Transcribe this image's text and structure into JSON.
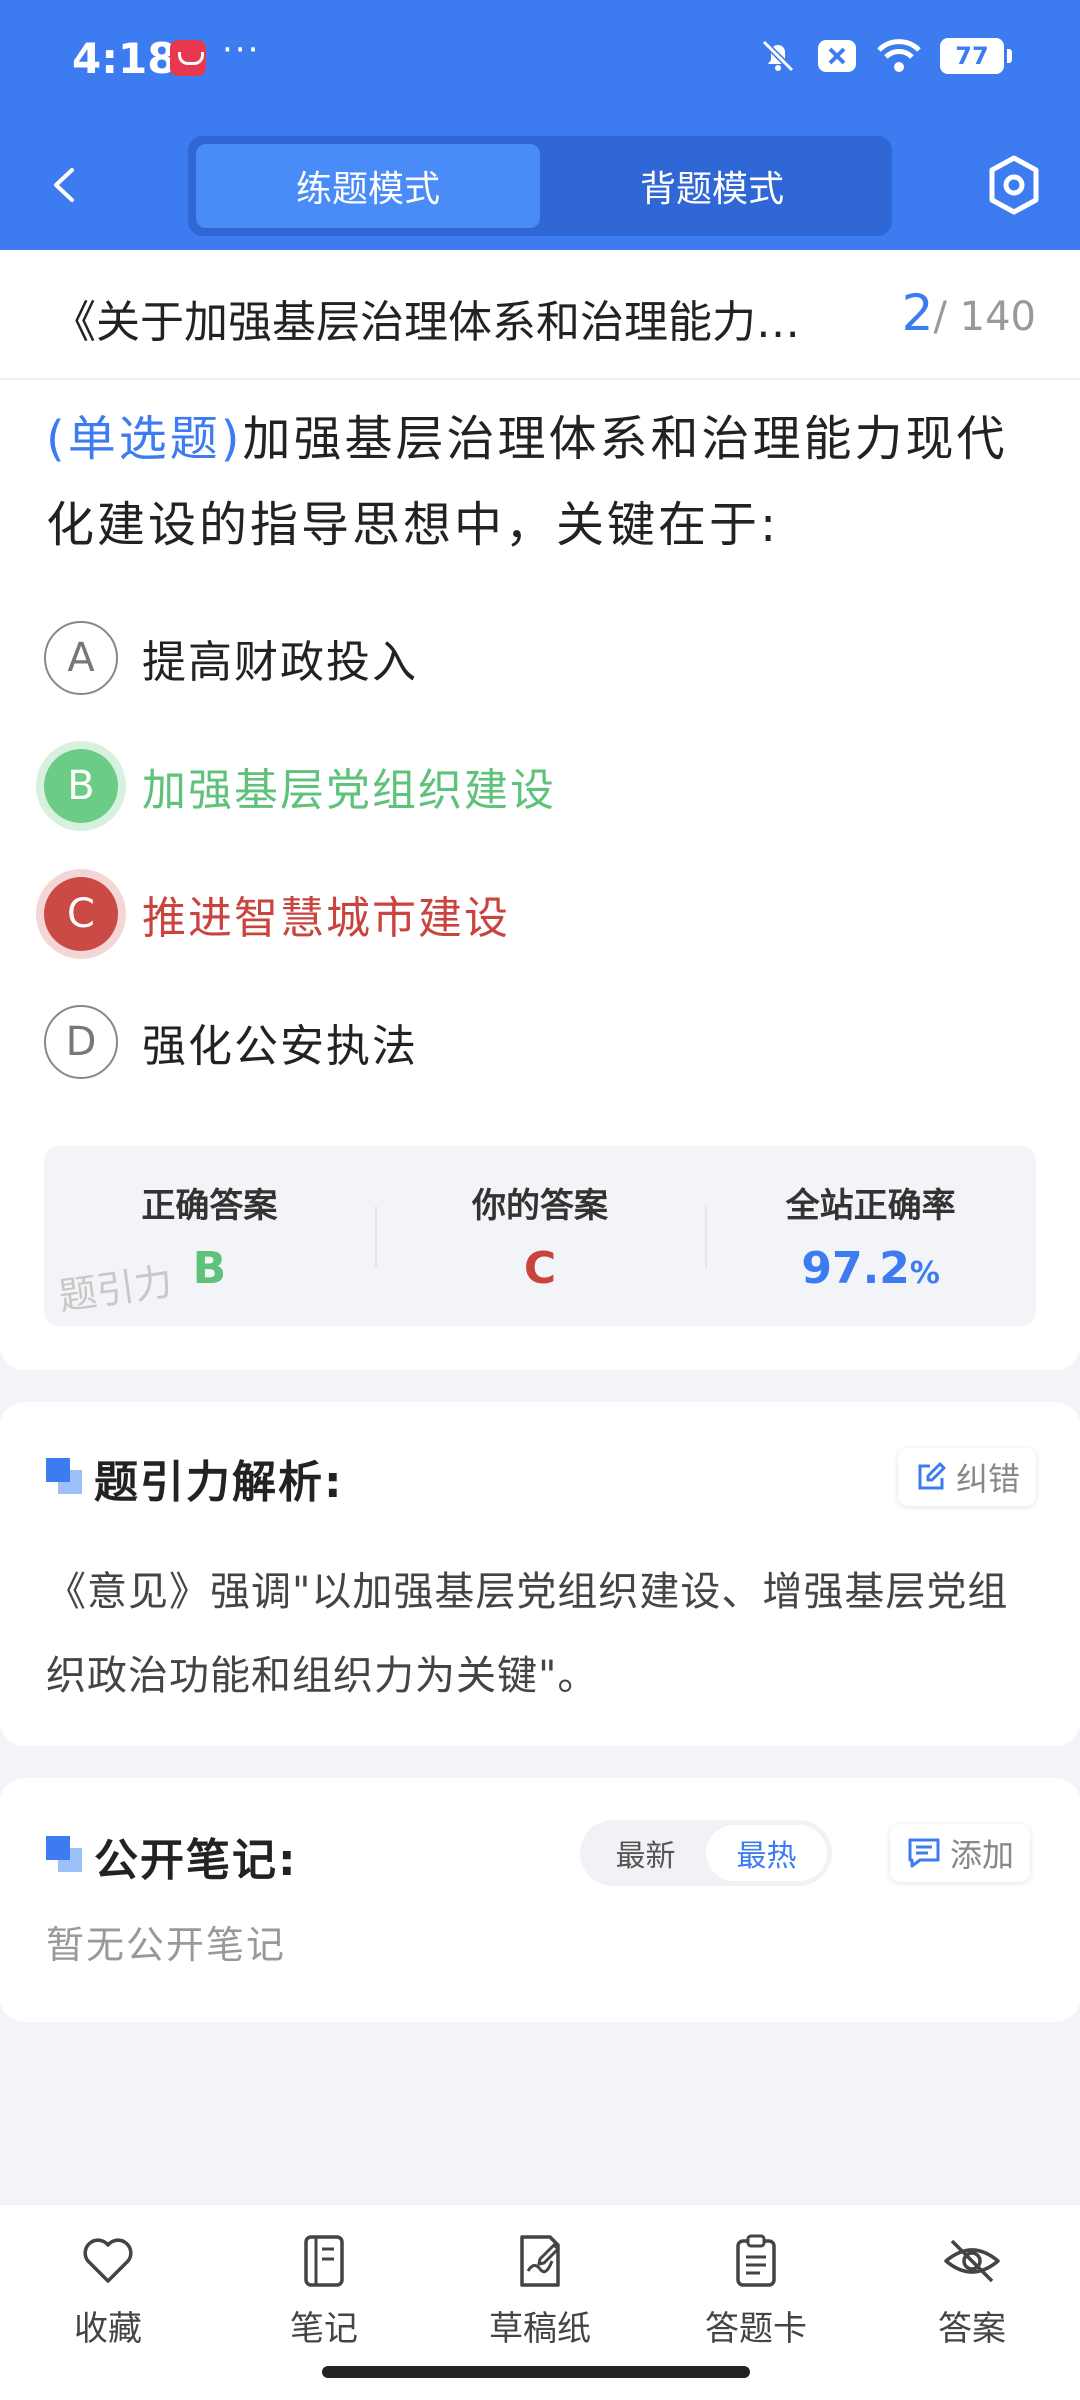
{
  "status_bar": {
    "time": "4:18",
    "more": "···",
    "battery": "77"
  },
  "nav": {
    "tab_practice": "练题模式",
    "tab_recite": "背题模式"
  },
  "question": {
    "doc_title": "《关于加强基层治理体系和治理能力…",
    "index_current": "2",
    "index_total": "/ 140",
    "type_label": "(单选题)",
    "text": "加强基层治理体系和治理能力现代化建设的指导思想中，关键在于:",
    "options": [
      {
        "letter": "A",
        "text": "提高财政投入"
      },
      {
        "letter": "B",
        "text": "加强基层党组织建设"
      },
      {
        "letter": "C",
        "text": "推进智慧城市建设"
      },
      {
        "letter": "D",
        "text": "强化公安执法"
      }
    ]
  },
  "answer_summary": {
    "correct_label": "正确答案",
    "correct_value": "B",
    "yours_label": "你的答案",
    "yours_value": "C",
    "rate_label": "全站正确率",
    "rate_value": "97.2",
    "rate_unit": "%",
    "watermark": "题引力"
  },
  "analysis": {
    "title": "题引力解析:",
    "report_label": "纠错",
    "text": "《意见》强调\"以加强基层党组织建设、增强基层党组织政治功能和组织力为关键\"。"
  },
  "notes": {
    "title": "公开笔记:",
    "sort_latest": "最新",
    "sort_hot": "最热",
    "add_label": "添加",
    "empty_text": "暂无公开笔记"
  },
  "bottom_bar": {
    "favorite": "收藏",
    "notes": "笔记",
    "draft": "草稿纸",
    "answer_card": "答题卡",
    "answer": "答案"
  },
  "colors": {
    "primary": "#3d7cf0",
    "correct": "#5ec27a",
    "wrong": "#c9443f"
  }
}
